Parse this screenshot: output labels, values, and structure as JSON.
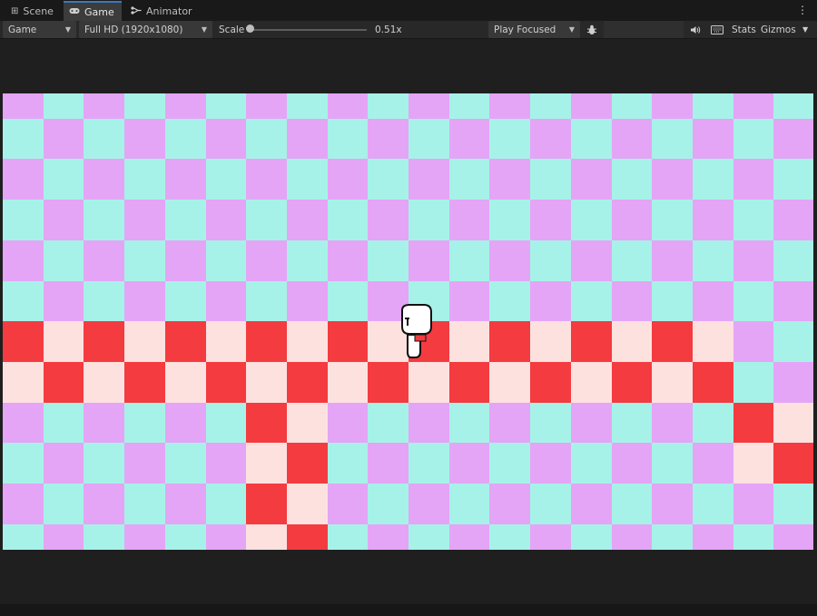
{
  "tabs": [
    {
      "label": "Scene",
      "icon": "grid-icon"
    },
    {
      "label": "Game",
      "icon": "gamepad-icon",
      "active": true
    },
    {
      "label": "Animator",
      "icon": "animator-icon"
    }
  ],
  "toolbar": {
    "display": "Game",
    "resolution": "Full HD (1920x1080)",
    "scale_label": "Scale",
    "scale_value": "0.51x",
    "play_mode": "Play Focused",
    "stats_label": "Stats",
    "gizmos_label": "Gizmos"
  },
  "colors": {
    "sky_a": "#e4a5f6",
    "sky_b": "#a7f2e8",
    "ground_a": "#f43b40",
    "ground_b": "#fde1df",
    "editor_bg": "#1e1e1e",
    "toolbar_bg": "#282828",
    "accent": "#3a79bb"
  },
  "game": {
    "ground_cells": [
      [
        0,
        0
      ],
      [
        1,
        1
      ],
      [
        2,
        0
      ],
      [
        3,
        1
      ],
      [
        4,
        0
      ],
      [
        5,
        1
      ],
      [
        6,
        0
      ],
      [
        7,
        1
      ],
      [
        8,
        0
      ],
      [
        9,
        1
      ],
      [
        10,
        0
      ],
      [
        11,
        1
      ],
      [
        12,
        0
      ],
      [
        13,
        1
      ],
      [
        14,
        0
      ],
      [
        15,
        1
      ],
      [
        16,
        0
      ],
      [
        17,
        1
      ],
      [
        0,
        1
      ],
      [
        1,
        0
      ],
      [
        2,
        1
      ],
      [
        3,
        0
      ],
      [
        4,
        1
      ],
      [
        5,
        0
      ],
      [
        6,
        1
      ],
      [
        7,
        0
      ],
      [
        8,
        1
      ],
      [
        9,
        0
      ],
      [
        10,
        1
      ],
      [
        11,
        0
      ],
      [
        12,
        1
      ],
      [
        13,
        0
      ],
      [
        14,
        1
      ],
      [
        15,
        0
      ],
      [
        16,
        1
      ],
      [
        17,
        0
      ],
      [
        6,
        2
      ],
      [
        7,
        2
      ],
      [
        6,
        3
      ],
      [
        7,
        3
      ],
      [
        6,
        4
      ],
      [
        7,
        4
      ],
      [
        6,
        5
      ],
      [
        7,
        5
      ],
      [
        18,
        2
      ],
      [
        19,
        2
      ],
      [
        18,
        3
      ],
      [
        19,
        3
      ]
    ],
    "player": {
      "name": "white-blob-character",
      "col": 9.7,
      "row": 5.55
    }
  }
}
